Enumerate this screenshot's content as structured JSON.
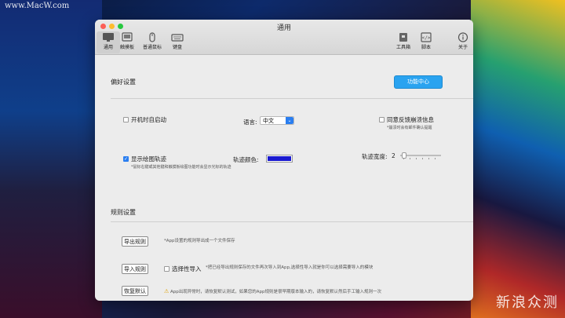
{
  "watermark": "www.MacW.com",
  "corner_mark": "新浪众测",
  "window": {
    "title": "通用"
  },
  "toolbar": {
    "left": [
      {
        "label": "通用",
        "icon": "monitor-icon",
        "active": true
      },
      {
        "label": "触摸板",
        "icon": "trackpad-icon",
        "active": false
      },
      {
        "label": "普通鼠标",
        "icon": "mouse-icon",
        "active": false
      },
      {
        "label": "键盘",
        "icon": "keyboard-icon",
        "active": false
      }
    ],
    "right": [
      {
        "label": "工具箱",
        "icon": "toolbox-icon"
      },
      {
        "label": "脚本",
        "icon": "script-icon"
      },
      {
        "label": "关于",
        "icon": "info-icon"
      }
    ]
  },
  "preferences": {
    "title": "偏好设置",
    "feature_center_button": "功能中心",
    "autostart_label": "开机时自启动",
    "autostart_checked": false,
    "language_label": "语言:",
    "language_value": "中文",
    "feedback_label": "同意反馈崩溃信息",
    "feedback_hint": "*崩溃时会有邮件确认提醒",
    "feedback_checked": false,
    "show_trail_label": "显示绘图轨迹",
    "show_trail_checked": true,
    "show_trail_hint": "*鼠标右键或其他键和触摸板绘图功能时会显示光标的轨迹",
    "trail_color_label": "轨迹颜色:",
    "trail_color": "#1a1ad0",
    "trail_width_label": "轨迹宽度:",
    "trail_width_value": "2"
  },
  "rules": {
    "title": "规则设置",
    "export_button": "导出规则",
    "export_hint": "*App设置的规则导出成一个文件保存",
    "import_button": "导入规则",
    "selective_import_label": "选择性导入",
    "selective_import_checked": false,
    "import_hint": "*把已经导出规则保存的文件再次导入到App,选择性导入就是你可以选择需要导入的模块",
    "restore_button": "恢复默认",
    "restore_hint": "App出现异常时，请恢复默认测试，如果您的App规则是很早期版本输入的，请恢复默认然后手工输入规则一次"
  }
}
